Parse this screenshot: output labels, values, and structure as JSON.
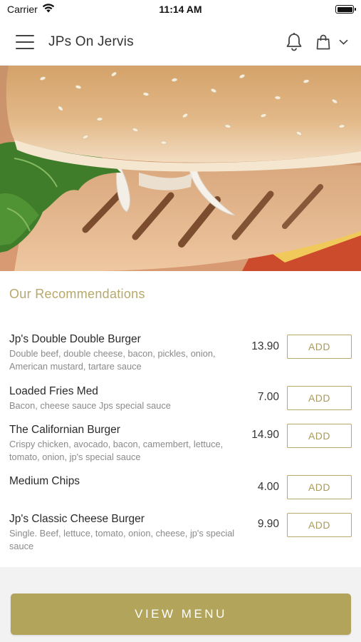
{
  "status_bar": {
    "carrier": "Carrier",
    "time": "11:14 AM"
  },
  "header": {
    "title": "JPs On Jervis",
    "icons": [
      "hamburger-menu-icon",
      "bell-icon",
      "shopping-bag-icon",
      "chevron-down-icon"
    ]
  },
  "section": {
    "title": "Our Recommendations"
  },
  "items": [
    {
      "name": "Jp's Double Double Burger",
      "description": "Double beef, double cheese, bacon, pickles, onion, American mustard, tartare sauce",
      "price": "13.90",
      "button": "ADD"
    },
    {
      "name": "Loaded Fries Med",
      "description": "Bacon, cheese sauce Jps special sauce",
      "price": "7.00",
      "button": "ADD"
    },
    {
      "name": "The Californian Burger",
      "description": "Crispy chicken, avocado, bacon, camembert, lettuce, tomato, onion, jp's special sauce",
      "price": "14.90",
      "button": "ADD"
    },
    {
      "name": "Medium Chips",
      "description": "",
      "price": "4.00",
      "button": "ADD"
    },
    {
      "name": "Jp's Classic Cheese Burger",
      "description": "Single. Beef, lettuce, tomato, onion, cheese, jp's special sauce",
      "price": "9.90",
      "button": "ADD"
    }
  ],
  "footer": {
    "view_menu_label": "VIEW MENU"
  },
  "colors": {
    "accent_gold": "#b3a45c",
    "section_title": "#b7a86b",
    "text_dark": "#2a2a2a",
    "text_muted": "#8a8a8a"
  }
}
